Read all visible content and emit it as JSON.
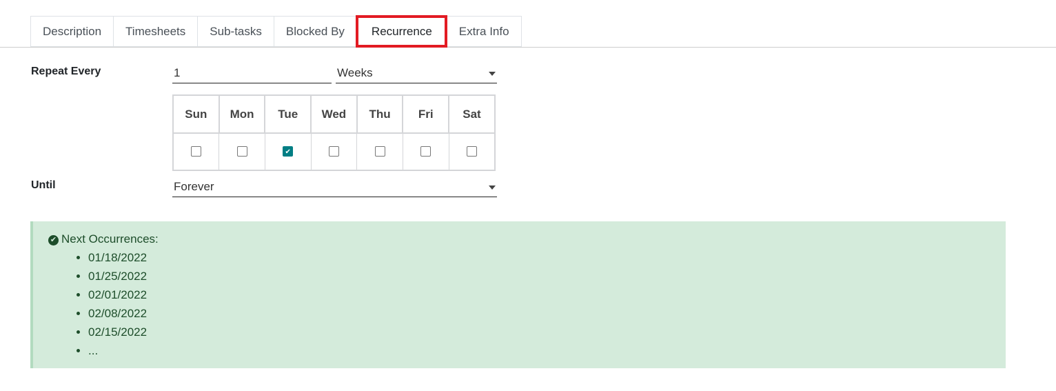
{
  "tabs": [
    "Description",
    "Timesheets",
    "Sub-tasks",
    "Blocked By",
    "Recurrence",
    "Extra Info"
  ],
  "active_tab": "Recurrence",
  "repeat": {
    "label": "Repeat Every",
    "interval": "1",
    "unit": "Weeks"
  },
  "days": [
    {
      "label": "Sun",
      "checked": false
    },
    {
      "label": "Mon",
      "checked": false
    },
    {
      "label": "Tue",
      "checked": true
    },
    {
      "label": "Wed",
      "checked": false
    },
    {
      "label": "Thu",
      "checked": false
    },
    {
      "label": "Fri",
      "checked": false
    },
    {
      "label": "Sat",
      "checked": false
    }
  ],
  "until": {
    "label": "Until",
    "value": "Forever"
  },
  "occurrences": {
    "title": "Next Occurrences:",
    "dates": [
      "01/18/2022",
      "01/25/2022",
      "02/01/2022",
      "02/08/2022",
      "02/15/2022",
      "..."
    ]
  },
  "colors": {
    "accent": "#017e84",
    "highlight": "#e21b23",
    "alert_bg": "#d4ebdb"
  }
}
